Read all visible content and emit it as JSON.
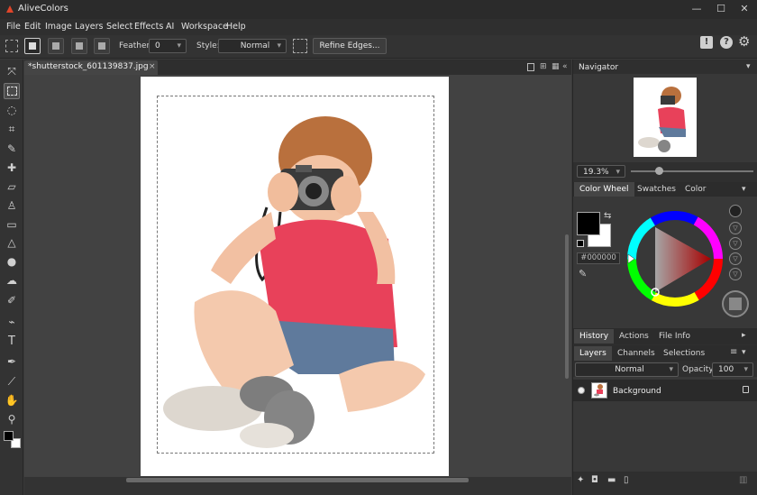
{
  "app": {
    "title": "AliveColors",
    "window_controls": {
      "minimize": "—",
      "maximize": "☐",
      "close": "✕"
    }
  },
  "menu": [
    "File",
    "Edit",
    "Image",
    "Layers",
    "Select",
    "Effects",
    "AI",
    "Workspace",
    "Help"
  ],
  "options_bar": {
    "feather_label": "Feather",
    "feather_value": "0",
    "style_label": "Style:",
    "style_value": "Normal",
    "refine_edges_label": "Refine Edges...",
    "help_icons": [
      "!",
      "?",
      "⚙"
    ]
  },
  "tools": [
    "move-icon",
    "rect-marquee-icon",
    "lasso-icon",
    "crop-icon",
    "brush-icon",
    "healing-icon",
    "eraser-icon",
    "stamp-icon",
    "fill-icon",
    "gradient-icon",
    "blur-icon",
    "smudge-icon",
    "pen-icon",
    "color-picker-icon",
    "text-icon",
    "path-icon",
    "eyedropper-icon",
    "hand-icon",
    "zoom-icon"
  ],
  "document": {
    "tab_label": "*shutterstock_601139837.jpg",
    "tab_close": "×"
  },
  "navigator": {
    "title": "Navigator",
    "zoom": "19.3%"
  },
  "color_panel": {
    "tabs": [
      "Color Wheel",
      "Swatches",
      "Color"
    ],
    "hex": "#000000",
    "foreground": "#000000",
    "background": "#ffffff"
  },
  "history_panel": {
    "tabs": [
      "History",
      "Actions",
      "File Info"
    ]
  },
  "layers_panel": {
    "tabs": [
      "Layers",
      "Channels",
      "Selections"
    ],
    "blend_mode": "Normal",
    "opacity_label": "Opacity:",
    "opacity_value": "100",
    "layers": [
      {
        "name": "Background",
        "locked": true,
        "visible": true
      }
    ]
  },
  "colors": {
    "accent": "#4a4a4a",
    "panel": "#2f2f2f",
    "canvas": "#424242"
  }
}
